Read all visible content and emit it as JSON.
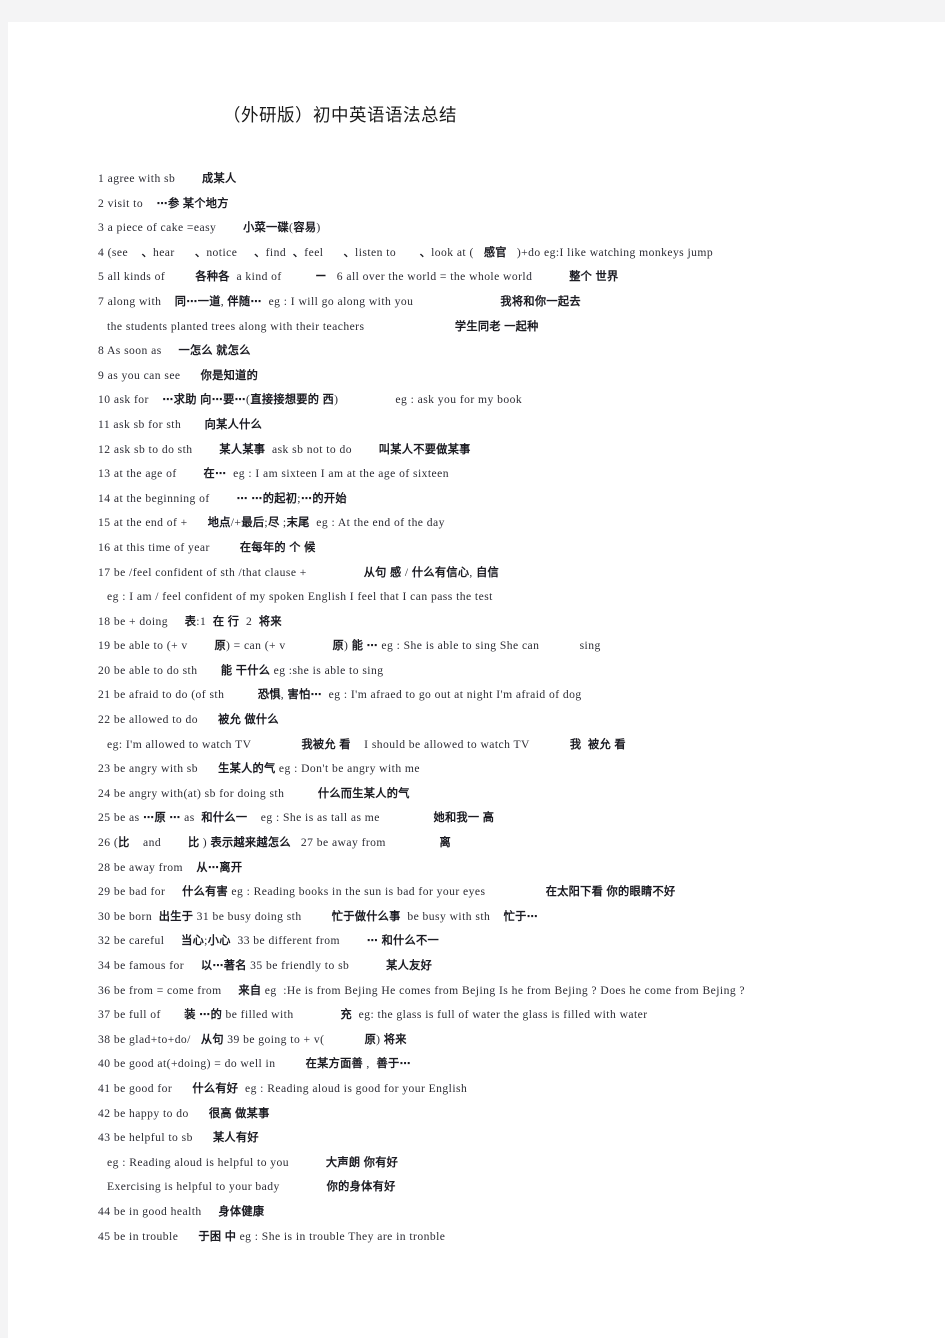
{
  "document": {
    "title": "（外研版）初中英语语法总结",
    "page_background": "#f4f4f5",
    "sheet_background": "#ffffff",
    "text_color": "#2b2b33"
  },
  "lines": [
    {
      "id": "l1",
      "text": "1 agree with sb        成某人",
      "indent": false
    },
    {
      "id": "l2",
      "text": "2 visit to    ⋯参 某个地方",
      "indent": false
    },
    {
      "id": "l3",
      "text": "3 a piece of cake =easy        小菜一碟(容易)",
      "indent": false
    },
    {
      "id": "l4",
      "text": "4 (see    、hear      、notice     、find  、feel      、listen to       、look at (   感官   )+do eg:I like watching monkeys jump",
      "indent": false
    },
    {
      "id": "l5",
      "text": "5 all kinds of         各种各  a kind of          ー   6 all over the world = the whole world           整个 世界",
      "indent": false
    },
    {
      "id": "l6",
      "text": "7 along with    同⋯一道, 伴随⋯  eg : I will go along with you                          我将和你一起去",
      "indent": false
    },
    {
      "id": "l7",
      "text": "the students planted trees along with their teachers                           学生同老 一起种",
      "indent": true
    },
    {
      "id": "l8",
      "text": "8 As soon as     一怎么 就怎么",
      "indent": false
    },
    {
      "id": "l9",
      "text": "9 as you can see      你是知道的",
      "indent": false
    },
    {
      "id": "l10",
      "text": "10 ask for    ⋯求助 向⋯要⋯(直接接想要的 西)                 eg : ask you for my book",
      "indent": false
    },
    {
      "id": "l11",
      "text": "11 ask sb for sth       向某人什么",
      "indent": false
    },
    {
      "id": "l12",
      "text": "12 ask sb to do sth        某人某事  ask sb not to do        叫某人不要做某事",
      "indent": false
    },
    {
      "id": "l13",
      "text": "13 at the age of        在⋯  eg : I am sixteen I am at the age of sixteen",
      "indent": false
    },
    {
      "id": "l14",
      "text": "14 at the beginning of        ⋯ ⋯的起初;⋯的开始",
      "indent": false
    },
    {
      "id": "l15",
      "text": "15 at the end of +      地点/+最后;尽 ;末尾  eg : At the end of the day",
      "indent": false
    },
    {
      "id": "l16",
      "text": "16 at this time of year         在每年的 个 候",
      "indent": false
    },
    {
      "id": "l17",
      "text": "17 be /feel confident of sth /that clause +                 从句 感 / 什么有信心, 自信",
      "indent": false
    },
    {
      "id": "l18",
      "text": "eg : I am / feel confident of my spoken English I feel that I can pass the test",
      "indent": true
    },
    {
      "id": "l19",
      "text": "18 be + doing     表:1  在 行  2  将来",
      "indent": false
    },
    {
      "id": "l20",
      "text": "19 be able to (+ v        原) = can (+ v              原) 能 ⋯ eg : She is able to sing She can            sing",
      "indent": false
    },
    {
      "id": "l21",
      "text": "20 be able to do sth       能 干什么 eg :she is able to sing",
      "indent": false
    },
    {
      "id": "l22",
      "text": "21 be afraid to do (of sth          恐惧, 害怕⋯  eg : I'm afraed to go out at night I'm afraid of dog",
      "indent": false
    },
    {
      "id": "l23",
      "text": "22 be allowed to do      被允 做什么",
      "indent": false
    },
    {
      "id": "l24",
      "text": "eg: I'm allowed to watch TV               我被允 看    I should be allowed to watch TV            我  被允 看",
      "indent": true
    },
    {
      "id": "l25",
      "text": "23 be angry with sb      生某人的气 eg : Don't be angry with me",
      "indent": false
    },
    {
      "id": "l26",
      "text": "24 be angry with(at) sb for doing sth          什么而生某人的气",
      "indent": false
    },
    {
      "id": "l27",
      "text": "25 be as ⋯原 ⋯ as  和什么一    eg : She is as tall as me                她和我一 高",
      "indent": false
    },
    {
      "id": "l28",
      "text": "26 (比    and        比 ) 表示越来越怎么   27 be away from                离",
      "indent": false
    },
    {
      "id": "l29",
      "text": "28 be away from    从⋯离开",
      "indent": false
    },
    {
      "id": "l30",
      "text": "29 be bad for     什么有害 eg : Reading books in the sun is bad for your eyes                  在太阳下看 你的眼睛不好",
      "indent": false
    },
    {
      "id": "l31",
      "text": "30 be born  出生于 31 be busy doing sth         忙于做什么事  be busy with sth    忙于⋯",
      "indent": false
    },
    {
      "id": "l32",
      "text": "32 be careful     当心;小心  33 be different from        ⋯ 和什么不一",
      "indent": false
    },
    {
      "id": "l33",
      "text": "34 be famous for     以⋯著名 35 be friendly to sb           某人友好",
      "indent": false
    },
    {
      "id": "l34",
      "text": "36 be from = come from     来自 eg  :He is from Bejing He comes from Bejing Is he from Bejing ? Does he come from Bejing ?",
      "indent": false
    },
    {
      "id": "l35",
      "text": "37 be full of       装 ⋯的 be filled with              充  eg: the glass is full of water the glass is filled with water",
      "indent": false
    },
    {
      "id": "l36",
      "text": "38 be glad+to+do/   从句 39 be going to + v(            原) 将来",
      "indent": false
    },
    {
      "id": "l37",
      "text": "40 be good at(+doing) = do well in         在某方面善 ,  善于⋯",
      "indent": false
    },
    {
      "id": "l38",
      "text": "41 be good for      什么有好  eg : Reading aloud is good for your English",
      "indent": false
    },
    {
      "id": "l39",
      "text": "42 be happy to do      很高 做某事",
      "indent": false
    },
    {
      "id": "l40",
      "text": "43 be helpful to sb      某人有好",
      "indent": false
    },
    {
      "id": "l41",
      "text": "eg : Reading aloud is helpful to you           大声朗 你有好",
      "indent": true
    },
    {
      "id": "l42",
      "text": "Exercising is helpful to your bady              你的身体有好",
      "indent": true
    },
    {
      "id": "l43",
      "text": "44 be in good health     身体健康",
      "indent": false
    },
    {
      "id": "l44",
      "text": "45 be in trouble      于困 中 eg : She is in trouble They are in tronble",
      "indent": false
    }
  ]
}
